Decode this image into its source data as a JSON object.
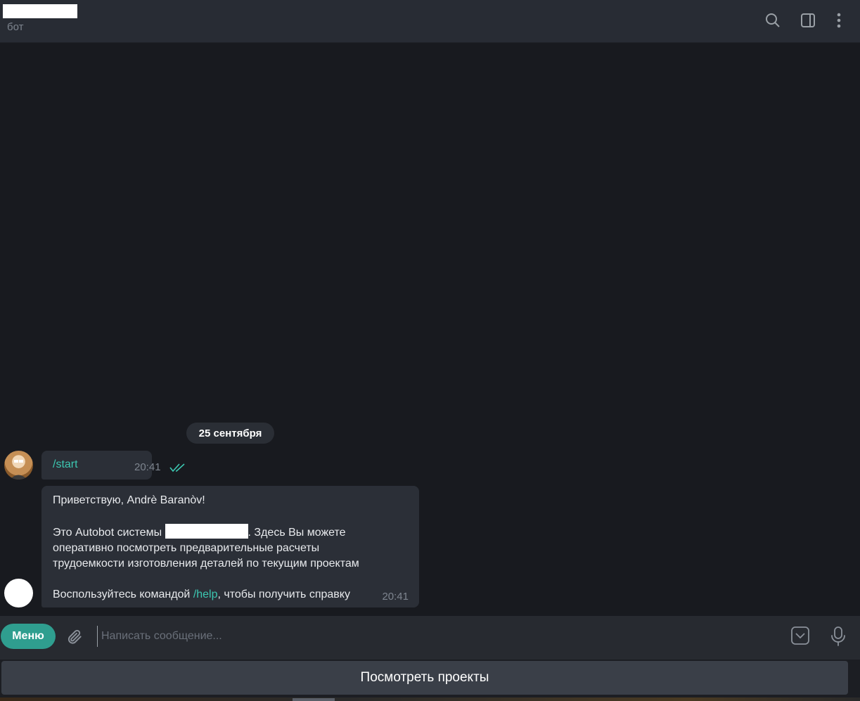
{
  "header": {
    "subtitle": "бот",
    "icons": [
      "search-icon",
      "sidebar-toggle-icon",
      "more-vertical-icon"
    ]
  },
  "chat": {
    "date_label": "25 сентября",
    "outgoing": {
      "text": "/start",
      "time": "20:41",
      "status": "read"
    },
    "incoming": {
      "greeting": "Приветствую, Andrè Baranòv!",
      "line2_prefix": "Это Autobot системы",
      "line2_suffix": ". Здесь Вы можете",
      "line3": "оперативно посмотреть предварительные расчеты",
      "line4": "трудоемкости изготовления деталей по текущим проектам",
      "line5_prefix": "Воспользуйтесь командой",
      "help_link": "/help",
      "line5_suffix": ", чтобы получить справку",
      "time": "20:41"
    }
  },
  "composer": {
    "menu_label": "Меню",
    "placeholder": "Написать сообщение..."
  },
  "keyboard": {
    "button_label": "Посмотреть проекты"
  },
  "colors": {
    "accent": "#3cc7b1",
    "menu_button": "#2f9e8f",
    "bubble": "#2b2f37",
    "background": "#181a1f"
  }
}
